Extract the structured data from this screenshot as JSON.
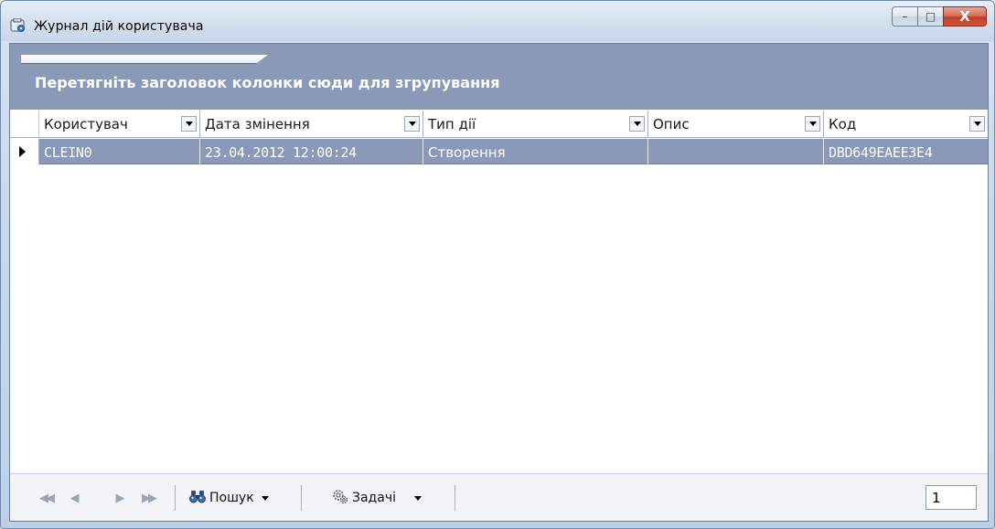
{
  "window": {
    "title": "Журнал дій користувача",
    "caption_buttons": {
      "minimize": "–",
      "maximize": "□",
      "close": "X"
    }
  },
  "grid": {
    "group_hint": "Перетягніть заголовок колонки сюди для згрупування",
    "columns": [
      "Користувач",
      "Дата змінення",
      "Тип дії",
      "Опис",
      "Код"
    ],
    "rows": [
      {
        "user": "CLEIN0",
        "date": "23.04.2012 12:00:24",
        "action_type": "Створення",
        "description": "",
        "code": "DBD649EAEE3E4"
      }
    ],
    "selected_color": "#8a99b7"
  },
  "footer": {
    "nav": {
      "first": "◀◀",
      "prev": "◀",
      "next": "▶",
      "last": "▶▶"
    },
    "search_label": "Пошук",
    "tasks_label": "Задачі",
    "page_number": "1"
  },
  "icons": {
    "app": "journal-window-icon",
    "search": "binoculars-icon",
    "tasks": "gears-icon"
  }
}
